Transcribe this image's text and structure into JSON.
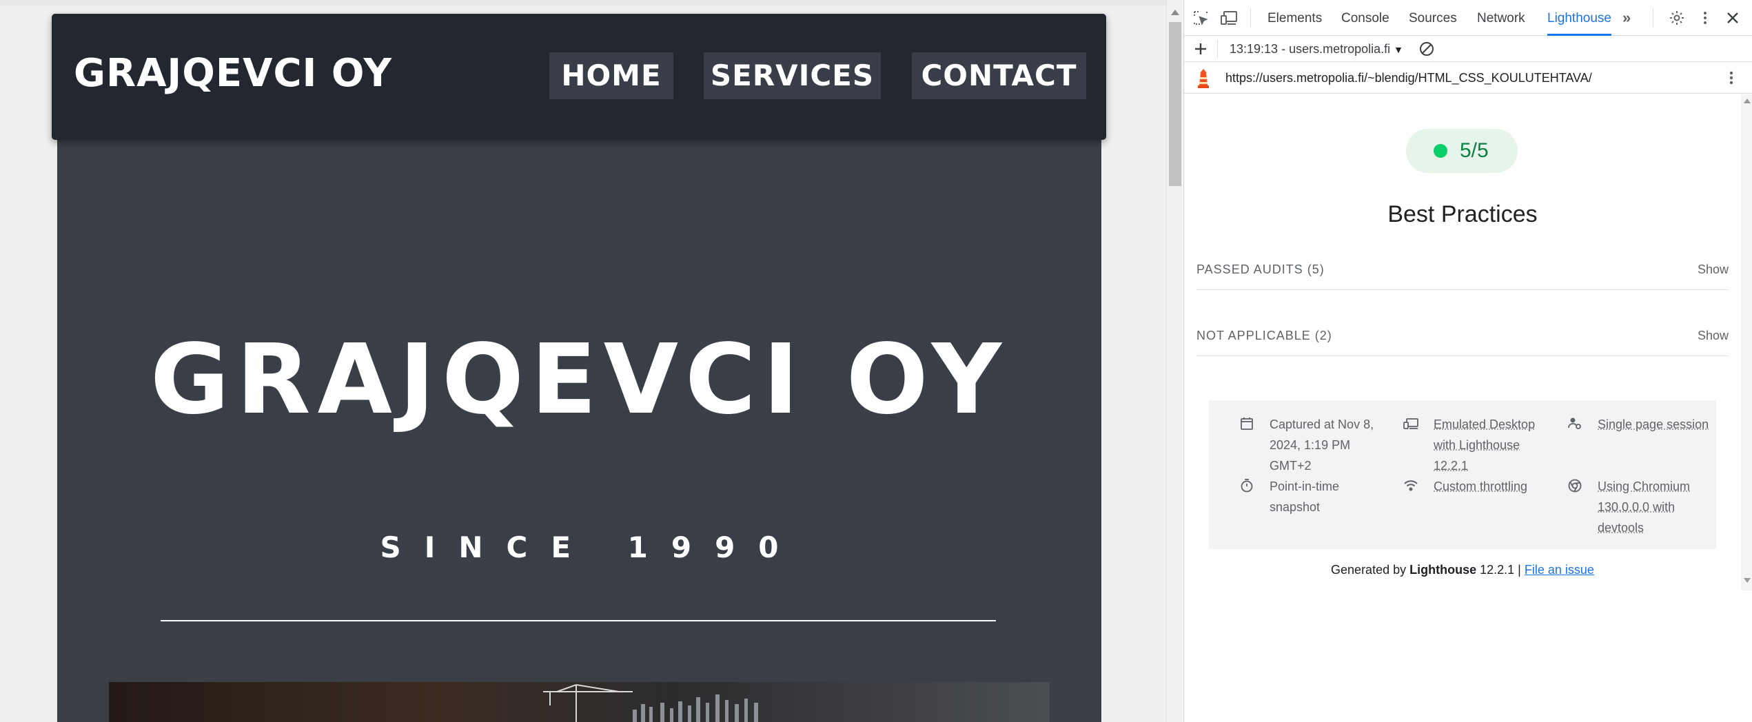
{
  "website": {
    "logo": "GRAJQEVCI OY",
    "nav": [
      {
        "label": "HOME"
      },
      {
        "label": "SERVICES"
      },
      {
        "label": "CONTACT"
      }
    ],
    "hero_title": "GRAJQEVCI OY",
    "hero_subtitle": "SINCE 1990"
  },
  "devtools": {
    "tabs": [
      "Elements",
      "Console",
      "Sources",
      "Network",
      "Lighthouse"
    ],
    "active_tab": "Lighthouse",
    "report_select": "13:19:13 - users.metropolia.fi",
    "url": "https://users.metropolia.fi/~blendig/HTML_CSS_KOULUTEHTAVA/",
    "score": "5/5",
    "score_color": "#0cce6b",
    "category": "Best Practices",
    "groups": [
      {
        "title": "PASSED AUDITS",
        "count": "(5)",
        "toggle": "Show"
      },
      {
        "title": "NOT APPLICABLE",
        "count": "(2)",
        "toggle": "Show"
      }
    ],
    "meta": {
      "captured": "Captured at Nov 8, 2024, 1:19 PM GMT+2",
      "emulated": "Emulated Desktop with Lighthouse 12.2.1",
      "session": "Single page session",
      "snapshot": "Point-in-time snapshot",
      "throttling": "Custom throttling",
      "chromium": "Using Chromium 130.0.0.0 with devtools"
    },
    "footer": {
      "prefix": "Generated by",
      "product": "Lighthouse",
      "version": "12.2.1 |",
      "link": "File an issue"
    },
    "accent_color": "#1a73e8"
  }
}
